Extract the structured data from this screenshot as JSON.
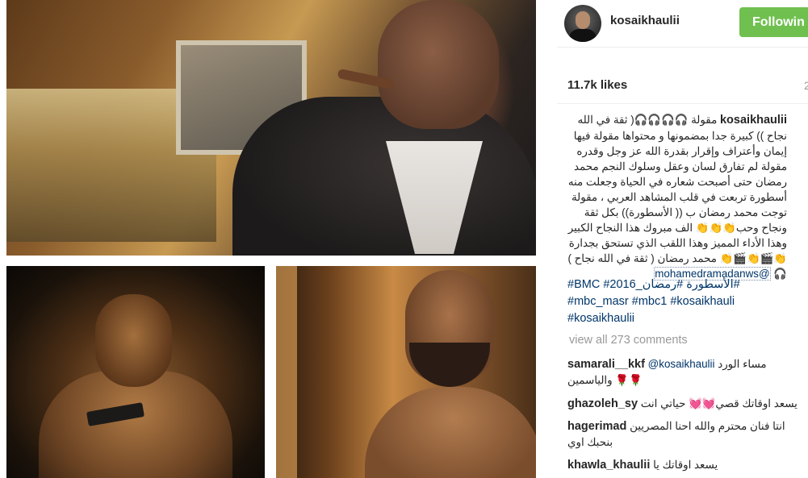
{
  "post": {
    "username": "kosaikhaulii",
    "follow_label": "Followin",
    "likes": "11.7k likes",
    "likes_extra": "2",
    "caption_user": "kosaikhaulii",
    "caption_text": "مقولة 🎧🎧🎧🎧( ثقة في الله نجاح )) كبيرة جدا بمضمونها و محتواها مقولة فيها إيمان وأعتراف وإقرار بقدرة الله عز وجل وقدره مقولة لم تفارق لسان وعقل وسلوك النجم محمد رمضان حتى أصبحت شعاره في الحياة وجعلت منه أسطورة تربعت في قلب المشاهد العربي ، مقولة توجت محمد رمضان ب (( الأسطورة)) بكل ثقة ونجاح وحب👏👏👏 الف مبروك هذا النجاح الكبير وهذا الأداء المميز وهذا اللقب الذي تستحق بجدارة 👏🎬👏🎬👏 محمد رمضان ( ثقة في الله نجاح ) 🎧",
    "mention": "@mohamedramadanws",
    "hashtags": "#BMC #الأسطورة #رمضان_2016# #mbc_masr #mbc1 #kosaikhauli #kosaikhaulii",
    "view_all": "view all 273 comments"
  },
  "comments": [
    {
      "user": "samarali__kkf",
      "mention": "@kosaikhaulii",
      "text": "مساء الورد والياسمين 🌹🌹"
    },
    {
      "user": "ghazoleh_sy",
      "text": "يسعد اوقاتك قصي💓💓 حياتي انت"
    },
    {
      "user": "hagerimad",
      "text": "انتا فنان محترم والله احنا المصريين بنحبك اوي"
    },
    {
      "user": "khawla_khaulii",
      "text": "يسعد اوقاتك يا"
    }
  ],
  "colors": {
    "follow_bg": "#70c050",
    "link": "#003569",
    "muted": "#999999"
  }
}
